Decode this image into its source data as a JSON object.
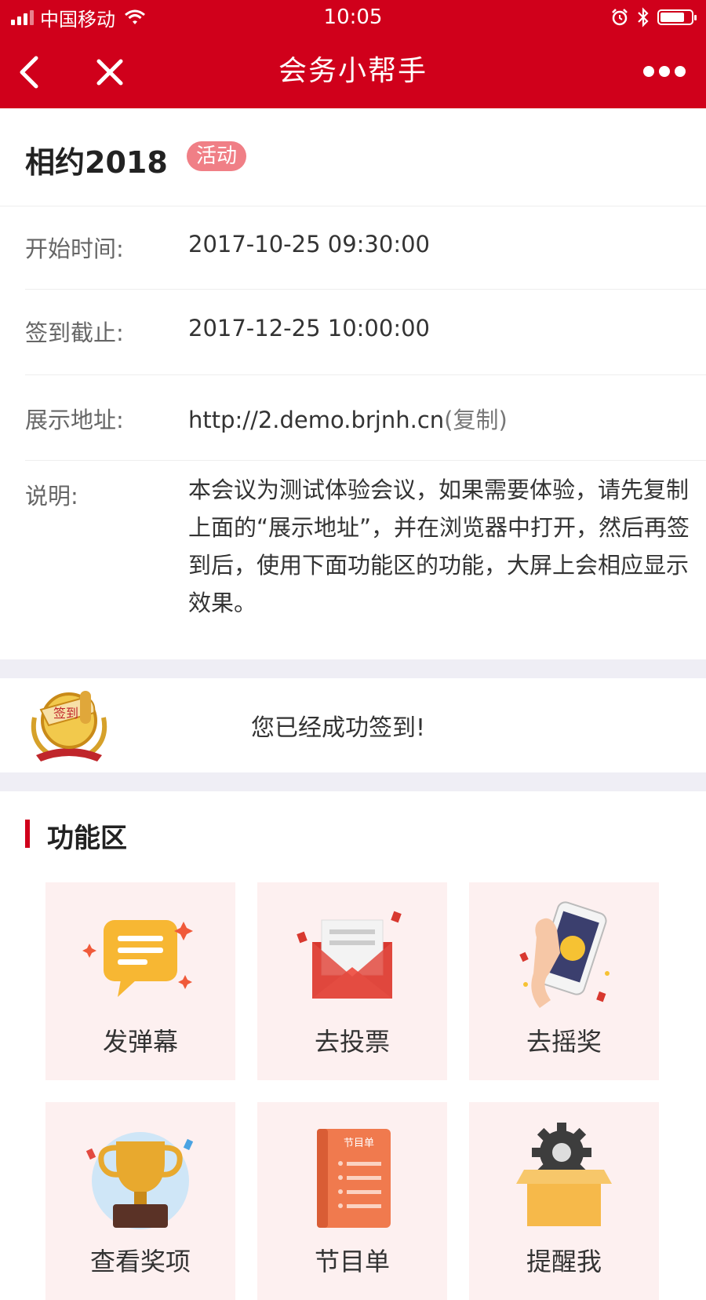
{
  "status_bar": {
    "carrier": "中国移动",
    "time": "10:05"
  },
  "nav": {
    "title": "会务小帮手"
  },
  "meeting": {
    "title": "相约2018",
    "tag": "活动",
    "start_label": "开始时间:",
    "start_value": "2017-10-25 09:30:00",
    "deadline_label": "签到截止:",
    "deadline_value": "2017-12-25 10:00:00",
    "address_label": "展示地址:",
    "address_value": "http://2.demo.brjnh.cn",
    "copy_label": "(复制)",
    "desc_label": "说明:",
    "desc_value": "本会议为测试体验会议，如果需要体验，请先复制上面的“展示地址”，并在浏览器中打开，然后再签到后，使用下面功能区的功能，大屏上会相应显示效果。"
  },
  "signin": {
    "badge_text": "签到",
    "message": "您已经成功签到!"
  },
  "features": {
    "title": "功能区",
    "items": [
      {
        "label": "发弹幕",
        "icon": "chat-bubble-icon"
      },
      {
        "label": "去投票",
        "icon": "envelope-icon"
      },
      {
        "label": "去摇奖",
        "icon": "phone-shake-icon"
      },
      {
        "label": "查看奖项",
        "icon": "trophy-icon"
      },
      {
        "label": "节目单",
        "icon": "program-book-icon",
        "book_text": "节目单"
      },
      {
        "label": "提醒我",
        "icon": "gear-box-icon"
      }
    ]
  },
  "colors": {
    "brand": "#d0001b",
    "tag": "#f07f86",
    "tile_bg": "#fdf0f0",
    "band": "#efeef5"
  }
}
